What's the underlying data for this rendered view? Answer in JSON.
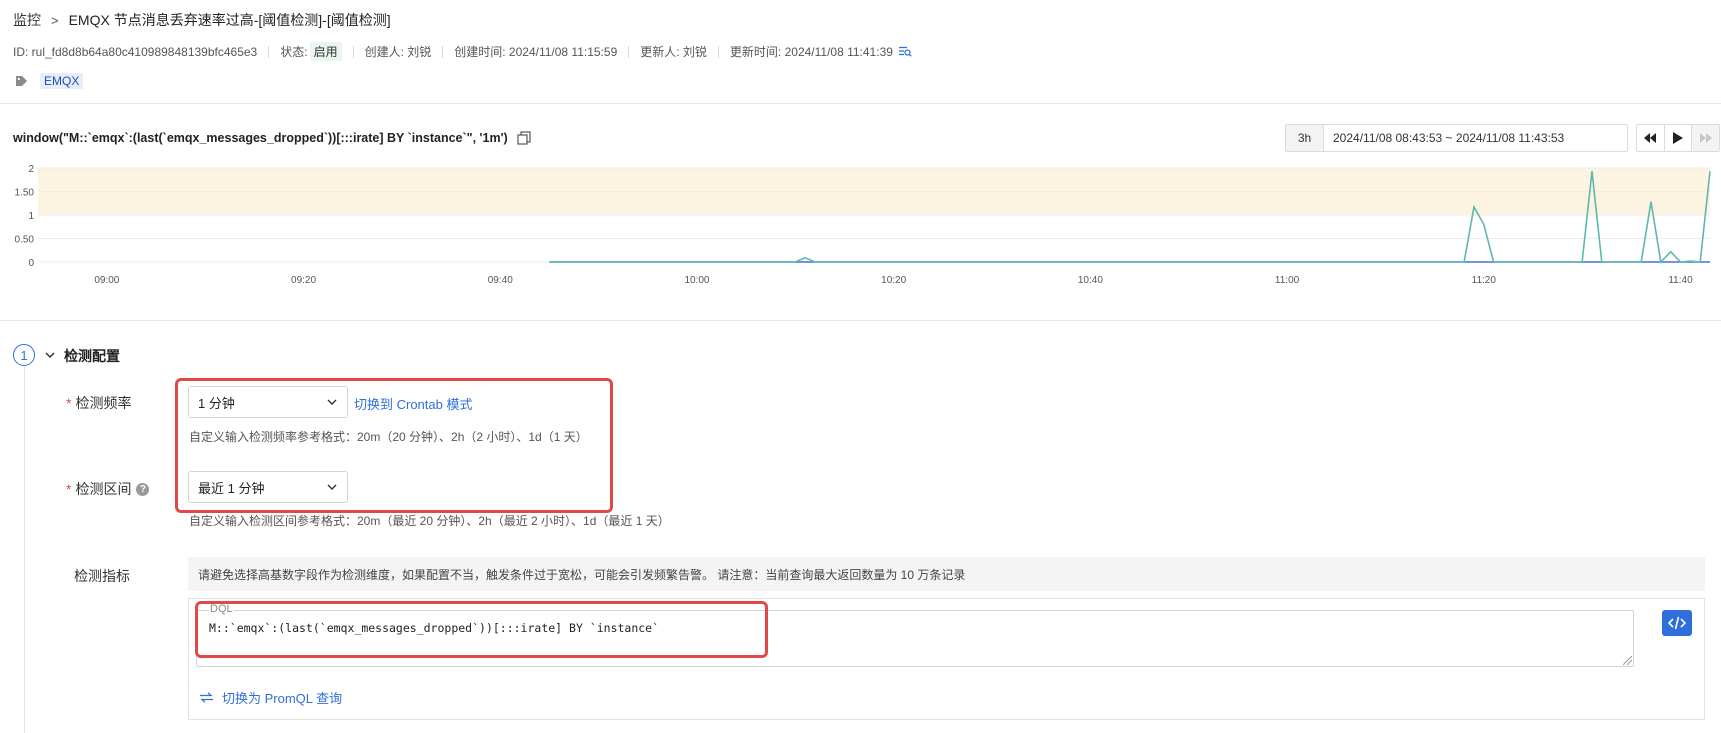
{
  "breadcrumb": {
    "root": "监控",
    "separator": ">",
    "title": "EMQX 节点消息丢弃速率过高-[阈值检测]-[阈值检测]"
  },
  "meta": {
    "id": "ID: rul_fd8d8b64a80c410989848139bfc465e3",
    "status_label": "状态:",
    "status_value": "启用",
    "creator": "创建人: 刘锐",
    "created_at": "创建时间: 2024/11/08 11:15:59",
    "updater": "更新人: 刘锐",
    "updated_at": "更新时间: 2024/11/08 11:41:39"
  },
  "tag": "EMQX",
  "query": {
    "text": "window(\"M::`emqx`:(last(`emqx_messages_dropped`))[:::irate] BY `instance`\", '1m')"
  },
  "time": {
    "range_button": "3h",
    "range_text": "2024/11/08 08:43:53 ~ 2024/11/08 11:43:53"
  },
  "colors": {
    "accent": "#2f6fdb",
    "threshold_band": "#fdf3e1",
    "series_green": "#5fb8ae",
    "series_blue": "#4b6fd6",
    "highlight_red": "#e34848"
  },
  "chart_data": {
    "type": "line",
    "y_ticks": [
      "2",
      "1.50",
      "1",
      "0.50",
      "0"
    ],
    "ylim": [
      0,
      2
    ],
    "x_range": [
      "08:53",
      "11:43"
    ],
    "x_ticks": [
      "09:00",
      "09:20",
      "09:40",
      "10:00",
      "10:20",
      "10:40",
      "11:00",
      "11:20",
      "11:40"
    ],
    "threshold_band": {
      "from": 1,
      "to": 2
    },
    "grid": true,
    "series": [
      {
        "x": [
          "09:45",
          "10:00",
          "10:10",
          "10:11",
          "10:12",
          "10:20",
          "10:40",
          "11:00",
          "11:10",
          "11:18",
          "11:19",
          "11:20",
          "11:21",
          "11:30",
          "11:31",
          "11:32",
          "11:33",
          "11:36",
          "11:37",
          "11:38",
          "11:39",
          "11:40",
          "11:41",
          "11:42",
          "11:43"
        ],
        "values": [
          0,
          0,
          0,
          0.09,
          0,
          0,
          0,
          0,
          0,
          0,
          1.17,
          0.8,
          0,
          0,
          1.93,
          0,
          0,
          0,
          1.28,
          0,
          0.22,
          0,
          0.02,
          0,
          1.93
        ]
      },
      {
        "x": [
          "09:45",
          "10:00",
          "10:20",
          "10:40",
          "11:00",
          "11:20",
          "11:40",
          "11:43"
        ],
        "values": [
          0,
          0,
          0,
          0,
          0,
          0,
          0,
          0
        ]
      }
    ]
  },
  "section": {
    "step": "1",
    "title": "检测配置"
  },
  "form": {
    "freq_label": "检测频率",
    "freq_value": "1 分钟",
    "crontab_link": "切换到 Crontab 模式",
    "freq_hint": "自定义输入检测频率参考格式：20m（20 分钟）、2h（2 小时）、1d（1 天）",
    "range_label": "检测区间",
    "range_value": "最近 1 分钟",
    "range_hint": "自定义输入检测区间参考格式：20m（最近 20 分钟）、2h（最近 2 小时）、1d（最近 1 天）",
    "metric_label": "检测指标",
    "notice": "请避免选择高基数字段作为检测维度，如果配置不当，触发条件过于宽松，可能会引发频繁告警。 请注意：当前查询最大返回数量为 10 万条记录",
    "dql_label": "DQL",
    "dql_code": "M::`emqx`:(last(`emqx_messages_dropped`))[:::irate] BY `instance`",
    "promql_link": "切换为 PromQL 查询"
  }
}
